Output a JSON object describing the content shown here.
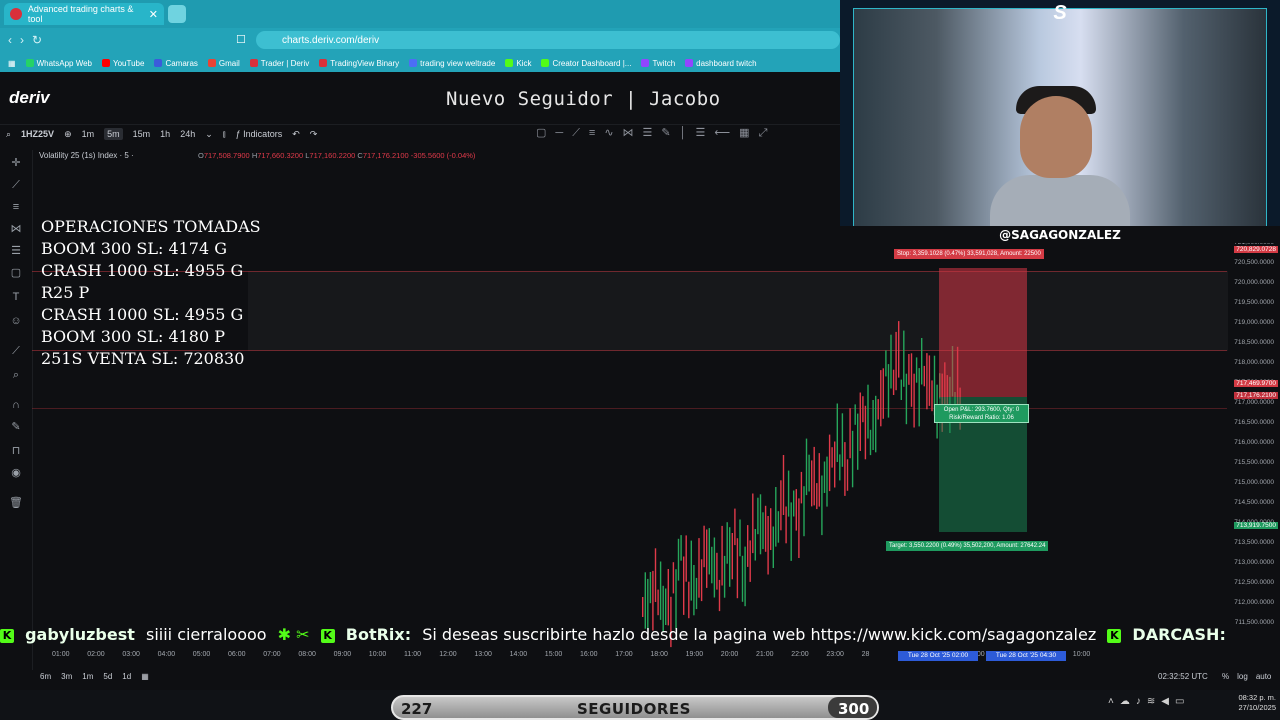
{
  "browser": {
    "tab_title": "Advanced trading charts & tool",
    "url": "charts.deriv.com/deriv",
    "bookmarks": [
      {
        "label": "WhatsApp Web",
        "color": "#25d366"
      },
      {
        "label": "YouTube",
        "color": "#ff0000"
      },
      {
        "label": "Camaras",
        "color": "#3b5bdb"
      },
      {
        "label": "Gmail",
        "color": "#ea4335"
      },
      {
        "label": "Trader | Deriv",
        "color": "#d9303b"
      },
      {
        "label": "TradingView Binary",
        "color": "#d9303b"
      },
      {
        "label": "trading view weltrade",
        "color": "#4c6ef5"
      },
      {
        "label": "Kick",
        "color": "#53fc18"
      },
      {
        "label": "Creator Dashboard |...",
        "color": "#53fc18"
      },
      {
        "label": "Twitch",
        "color": "#9146ff"
      },
      {
        "label": "dashboard twitch",
        "color": "#9146ff"
      }
    ]
  },
  "header": {
    "logo": "deriv",
    "banner": "Nuevo Seguidor | Jacobo"
  },
  "toolbar": {
    "symbol": "1HZ25V",
    "intervals": [
      "1m",
      "5m",
      "15m",
      "1h",
      "24h"
    ],
    "active_interval": "5m",
    "indicators": "Indicators"
  },
  "legend": {
    "title": "Volatility 25 (1s) Index · 5 ·",
    "o": "717,508.7900",
    "h": "717,660.3200",
    "l": "717,160.2200",
    "c": "717,176.2100",
    "change": "-305.5600 (-0.04%)"
  },
  "operations": {
    "lines": [
      "OPERACIONES TOMADAS",
      "BOOM 300 SL: 4174 G",
      "CRASH 1000 SL: 4955 G",
      "R25 P",
      "CRASH 1000 SL: 4955 G",
      "BOOM 300 SL: 4180 P",
      "251S VENTA SL: 720830"
    ]
  },
  "position": {
    "stop": "Stop: 3,359.1028 (0.47%) 33,591,028, Amount: 22500",
    "target": "Target: 3,550.2200 (0.49%) 35,502,200, Amount: 27642.24",
    "open_line1": "Open P&L: 293.7600, Qty: 0",
    "open_line2": "Risk/Reward Ratio: 1.06"
  },
  "price_axis": {
    "labels": [
      "721,000.0000",
      "720,500.0000",
      "720,000.0000",
      "719,500.0000",
      "719,000.0000",
      "718,500.0000",
      "718,000.0000",
      "717,500.0000",
      "717,000.0000",
      "716,500.0000",
      "716,000.0000",
      "715,500.0000",
      "715,000.0000",
      "714,500.0000",
      "714,000.0000",
      "713,500.0000",
      "713,000.0000",
      "712,500.0000",
      "712,000.0000",
      "711,500.0000"
    ],
    "tag_stop": "720,829.0728",
    "tag_entry": "717,469.9700",
    "tag_current": "717,176.2100",
    "tag_target": "713,919.7500"
  },
  "time_axis": {
    "labels": [
      "01:00",
      "02:00",
      "03:00",
      "04:00",
      "05:00",
      "06:00",
      "07:00",
      "08:00",
      "09:00",
      "10:00",
      "11:00",
      "12:00",
      "13:00",
      "14:00",
      "15:00",
      "16:00",
      "17:00",
      "18:00",
      "19:00",
      "20:00",
      "21:00",
      "22:00",
      "23:00",
      "28",
      "",
      "",
      "07:00",
      "08:00",
      "09:00",
      "10:00"
    ],
    "tag1": "Tue 28 Oct '25  02:00",
    "tag2": "Tue 28 Oct '25  04:30"
  },
  "bottom": {
    "ranges": [
      "6m",
      "3m",
      "1m",
      "5d",
      "1d"
    ],
    "clock": "02:32:52 UTC",
    "pct": "%",
    "log": "log",
    "auto": "auto"
  },
  "ticker": {
    "user1": "gabyluzbest",
    "msg1": "siiii cierraloooo",
    "user2": "BotRix:",
    "msg2": "Si deseas suscribirte hazlo desde la pagina web https://www.kick.com/sagagonzalez",
    "user3": "DARCASH:"
  },
  "webcam": {
    "handle": "@SAGAGONZALEZ",
    "logo": "S"
  },
  "follow_goal": {
    "count": "227",
    "label": "SEGUIDORES",
    "goal": "300"
  },
  "system": {
    "time": "08:32 p. m.",
    "date": "27/10/2025"
  },
  "colors": {
    "stop_zone": "#d43b45",
    "target_zone": "#1f9a5f",
    "accent_blue": "#2d5bd8",
    "browser_teal": "#1f9bb0"
  },
  "chart_data": {
    "type": "candlestick",
    "note_series": [
      {
        "t": 0.0,
        "v": 711900
      },
      {
        "t": 0.04,
        "v": 712400
      },
      {
        "t": 0.08,
        "v": 711700
      },
      {
        "t": 0.12,
        "v": 713000
      },
      {
        "t": 0.16,
        "v": 712200
      },
      {
        "t": 0.2,
        "v": 713300
      },
      {
        "t": 0.24,
        "v": 712600
      },
      {
        "t": 0.28,
        "v": 713600
      },
      {
        "t": 0.32,
        "v": 712900
      },
      {
        "t": 0.36,
        "v": 714100
      },
      {
        "t": 0.4,
        "v": 713500
      },
      {
        "t": 0.44,
        "v": 714500
      },
      {
        "t": 0.48,
        "v": 714000
      },
      {
        "t": 0.52,
        "v": 715200
      },
      {
        "t": 0.56,
        "v": 714700
      },
      {
        "t": 0.6,
        "v": 715900
      },
      {
        "t": 0.64,
        "v": 715600
      },
      {
        "t": 0.68,
        "v": 716700
      },
      {
        "t": 0.72,
        "v": 716300
      },
      {
        "t": 0.76,
        "v": 717600
      },
      {
        "t": 0.8,
        "v": 717900
      },
      {
        "t": 0.84,
        "v": 717300
      },
      {
        "t": 0.88,
        "v": 717700
      },
      {
        "t": 0.92,
        "v": 717100
      },
      {
        "t": 0.96,
        "v": 717400
      },
      {
        "t": 1.0,
        "v": 717176
      }
    ],
    "ylim": [
      711500,
      721000
    ]
  }
}
